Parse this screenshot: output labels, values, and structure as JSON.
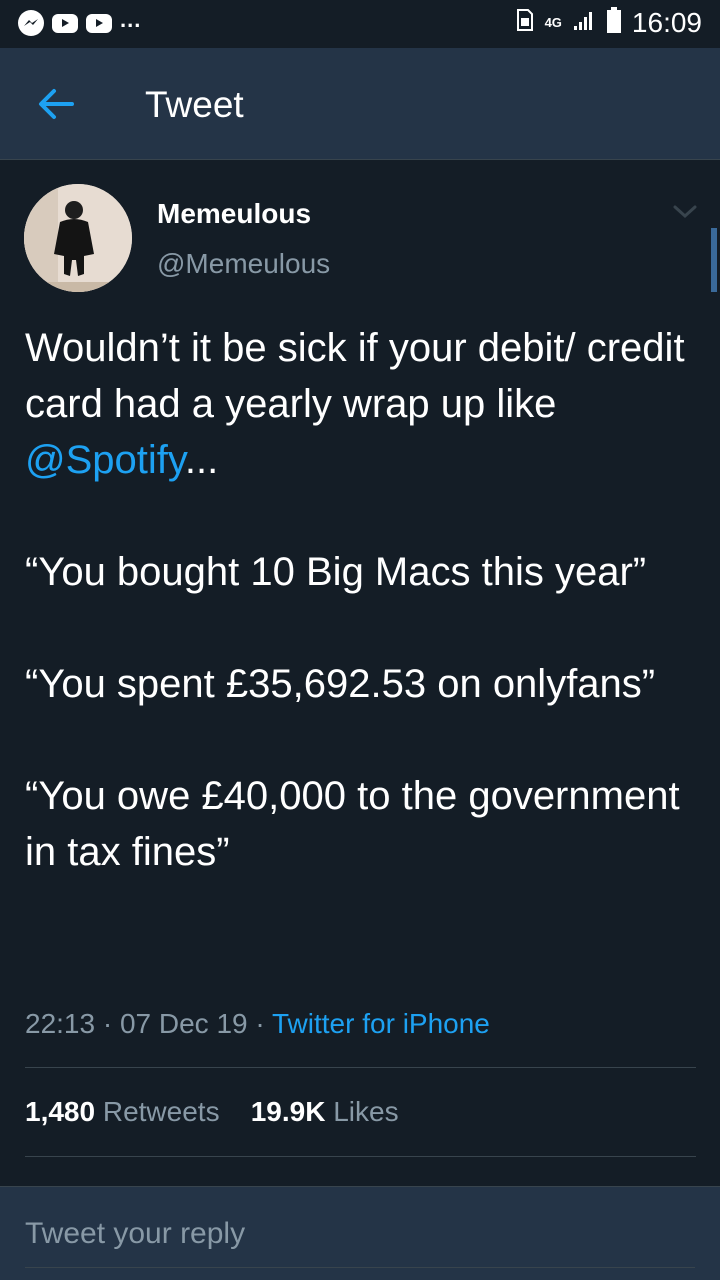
{
  "status_bar": {
    "time": "16:09",
    "network": "4G",
    "icons": [
      "messenger-icon",
      "youtube-icon",
      "youtube-icon",
      "more-notifications-icon",
      "sim-icon",
      "signal-icon",
      "battery-icon"
    ]
  },
  "app_bar": {
    "title": "Tweet",
    "back_icon": "arrow-left-icon"
  },
  "tweet": {
    "display_name": "Memeulous",
    "handle": "@Memeulous",
    "body": {
      "p1_text": "Wouldn’t it be sick if your debit/ credit card had a yearly wrap up like ",
      "p1_mention": "@Spotify",
      "p1_suffix": "...",
      "p2": "“You bought 10 Big Macs this year”",
      "p3": "“You spent £35,692.53 on onlyfans”",
      "p4": "“You owe £40,000 to the government in tax fines”"
    },
    "time": "22:13",
    "date": "07 Dec 19",
    "separator": "·",
    "source": "Twitter for iPhone",
    "retweets_count": "1,480",
    "retweets_label": "Retweets",
    "likes_count": "19.9K",
    "likes_label": "Likes"
  },
  "reply": {
    "placeholder": "Tweet your reply"
  },
  "colors": {
    "background": "#141d26",
    "header": "#243447",
    "accent": "#1da1f2",
    "secondary_text": "#8899a6"
  }
}
